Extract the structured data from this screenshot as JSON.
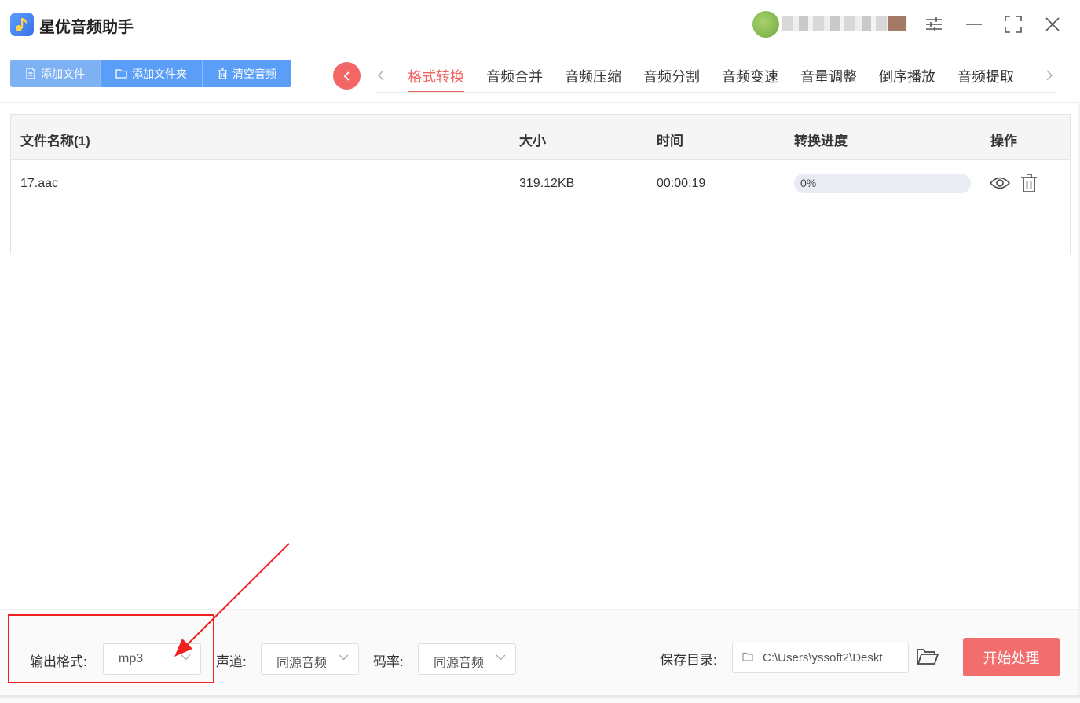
{
  "app": {
    "title": "星优音频助手"
  },
  "toolbar": {
    "add_file": "添加文件",
    "add_folder": "添加文件夹",
    "clear_audio": "清空音频"
  },
  "tabs": [
    {
      "label": "格式转换",
      "active": true
    },
    {
      "label": "音频合并"
    },
    {
      "label": "音频压缩"
    },
    {
      "label": "音频分割"
    },
    {
      "label": "音频变速"
    },
    {
      "label": "音量调整"
    },
    {
      "label": "倒序播放"
    },
    {
      "label": "音频提取"
    }
  ],
  "table": {
    "headers": {
      "name": "文件名称(1)",
      "size": "大小",
      "time": "时间",
      "progress": "转换进度",
      "actions": "操作"
    },
    "rows": [
      {
        "name": "17.aac",
        "size": "319.12KB",
        "time": "00:00:19",
        "progress_text": "0%",
        "progress": 0
      }
    ]
  },
  "settings": {
    "format_label": "输出格式:",
    "format_value": "mp3",
    "channel_label": "声道:",
    "channel_value": "同源音频",
    "bitrate_label": "码率:",
    "bitrate_value": "同源音频",
    "save_label": "保存目录:",
    "save_path": "C:\\Users\\yssoft2\\Deskt",
    "start_button": "开始处理"
  },
  "colors": {
    "accent_red": "#f26363",
    "button_blue": "#5a9ef7",
    "annotation_red": "#f0201f"
  }
}
